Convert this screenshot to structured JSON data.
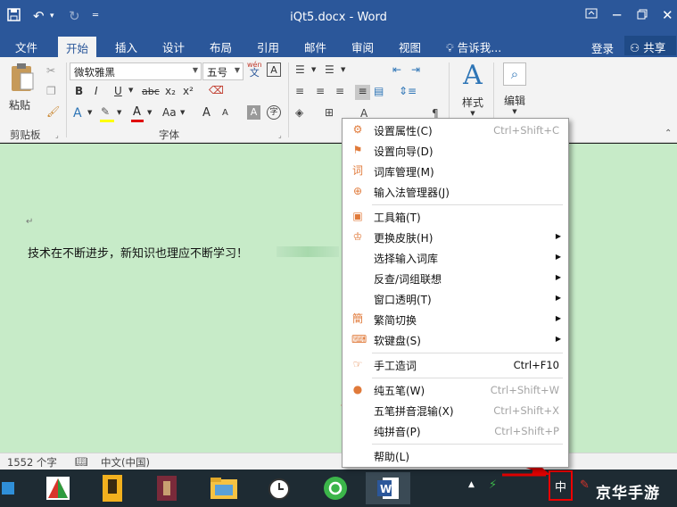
{
  "titlebar": {
    "title": "iQt5.docx - Word",
    "save_icon": "save-icon",
    "undo_icon": "undo-icon",
    "redo_icon": "redo-icon",
    "customize_icon": "customize-icon"
  },
  "tabs": [
    "文件",
    "开始",
    "插入",
    "设计",
    "布局",
    "引用",
    "邮件",
    "审阅",
    "视图"
  ],
  "active_tab": "开始",
  "tell_me": "告诉我...",
  "login": "登录",
  "share": "共享",
  "ribbon": {
    "paste_label": "粘贴",
    "clipboard_label": "剪贴板",
    "font_name": "微软雅黑",
    "font_size": "五号",
    "wen": "wén",
    "wen_char": "文",
    "font_group_label": "字体",
    "bold": "B",
    "italic": "I",
    "underline": "U",
    "strike": "abc",
    "subscript": "x₂",
    "superscript": "x²",
    "font_color_a": "A",
    "aa": "Aa",
    "grow": "A",
    "shrink": "A",
    "styles_label": "样式",
    "editing_label": "编辑"
  },
  "document": {
    "paragraph_mark": "↵",
    "text": "技术在不断进步，新知识也理应不断学习！"
  },
  "statusbar": {
    "word_count": "1552 个字",
    "language": "中文(中国)"
  },
  "context_menu": {
    "items": [
      {
        "label": "设置属性(C)",
        "shortcut": "Ctrl+Shift+C",
        "icon": "gear-icon",
        "arrow": false
      },
      {
        "label": "设置向导(D)",
        "shortcut": "",
        "icon": "flag-icon",
        "arrow": false
      },
      {
        "label": "词库管理(M)",
        "shortcut": "",
        "icon": "dictionary-icon",
        "arrow": false
      },
      {
        "label": "输入法管理器(J)",
        "shortcut": "",
        "icon": "globe-icon",
        "arrow": false
      },
      {
        "label": "工具箱(T)",
        "shortcut": "",
        "icon": "toolbox-icon",
        "arrow": false
      },
      {
        "label": "更换皮肤(H)",
        "shortcut": "",
        "icon": "shirt-icon",
        "arrow": true
      },
      {
        "label": "选择输入词库",
        "shortcut": "",
        "icon": "",
        "arrow": true
      },
      {
        "label": "反查/词组联想",
        "shortcut": "",
        "icon": "",
        "arrow": true
      },
      {
        "label": "窗口透明(T)",
        "shortcut": "",
        "icon": "",
        "arrow": true
      },
      {
        "label": "繁简切换",
        "shortcut": "",
        "icon": "convert-icon",
        "arrow": true
      },
      {
        "label": "软键盘(S)",
        "shortcut": "",
        "icon": "keyboard-icon",
        "arrow": true
      },
      {
        "label": "手工造词",
        "shortcut": "Ctrl+F10",
        "icon": "hand-icon",
        "arrow": false
      },
      {
        "label": "纯五笔(W)",
        "shortcut": "Ctrl+Shift+W",
        "icon": "dot-icon",
        "arrow": false
      },
      {
        "label": "五笔拼音混输(X)",
        "shortcut": "Ctrl+Shift+X",
        "icon": "",
        "arrow": false
      },
      {
        "label": "纯拼音(P)",
        "shortcut": "Ctrl+Shift+P",
        "icon": "",
        "arrow": false
      },
      {
        "label": "帮助(L)",
        "shortcut": "",
        "icon": "",
        "arrow": false
      }
    ]
  },
  "tray": {
    "ime_label": "中",
    "watermark": "京华手游"
  },
  "colors": {
    "word_blue": "#2b579a",
    "doc_background": "#c7ebc8",
    "annotation_red": "#e00000",
    "menu_icon": "#e07a3a"
  }
}
